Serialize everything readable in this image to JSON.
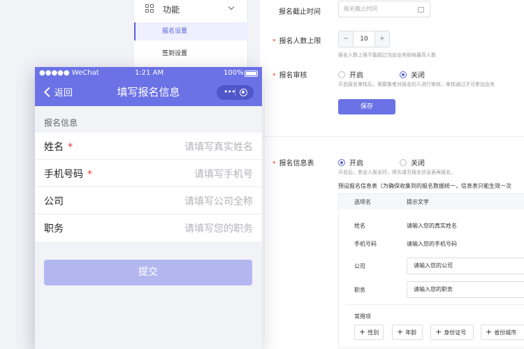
{
  "sidebar": {
    "function_label": "功能",
    "items": [
      {
        "label": "报名设置",
        "active": true
      },
      {
        "label": "签到设置",
        "active": false
      }
    ]
  },
  "settings": {
    "deadline": {
      "label": "报名截止时间",
      "placeholder": "报名截止时间"
    },
    "limit": {
      "label": "报名人数上限",
      "minus": "−",
      "value": "10",
      "plus": "+",
      "hint": "报名人数上限不能超过当前会务规格最高人数"
    },
    "review": {
      "label": "报名审核",
      "options": [
        "开启",
        "关闭"
      ],
      "selected": "关闭",
      "hint": "开启报名审核后，需要备者对报名的人进行审核，审核通过才可参加会务"
    },
    "save_label": "保存",
    "form_table": {
      "label": "报名信息表",
      "options": [
        "开启",
        "关闭"
      ],
      "selected": "开启",
      "hint": "开启后，参会人报名时，将先填写报名信息表再报名。",
      "desc": "预设报名信息表（为确保收集到的报名数据统一，信息表只能生效一次",
      "columns": [
        "选项名",
        "提示文字"
      ],
      "rows": [
        {
          "name": "姓名",
          "tip": "请输入您的真实姓名",
          "input": false
        },
        {
          "name": "手机号码",
          "tip": "请输入您的手机号码",
          "input": false
        },
        {
          "name": "公司",
          "tip": "请输入您的公司",
          "input": true
        },
        {
          "name": "职务",
          "tip": "请输入您的职务",
          "input": true
        }
      ],
      "common_label": "常用项",
      "tags": [
        "性别",
        "年龄",
        "身份证号",
        "省份城市"
      ],
      "tag_plus": "+"
    }
  },
  "phone": {
    "status": {
      "carrier": "●●●●● WeChat",
      "time": "1:21 AM",
      "battery": "100%"
    },
    "nav": {
      "back": "返回",
      "title": "填写报名信息",
      "more": "•••"
    },
    "section_title": "报名信息",
    "fields": [
      {
        "label": "姓名",
        "required": "*",
        "placeholder": "请填写真实姓名"
      },
      {
        "label": "手机号码",
        "required": "*",
        "placeholder": "请填写手机号"
      },
      {
        "label": "公司",
        "required": "",
        "placeholder": "请填写公司全称"
      },
      {
        "label": "职务",
        "required": "",
        "placeholder": "请填写您的职务"
      }
    ],
    "submit_label": "提交"
  },
  "colors": {
    "accent": "#6b72e6",
    "required": "#e33333",
    "background": "#f2f3f7"
  }
}
